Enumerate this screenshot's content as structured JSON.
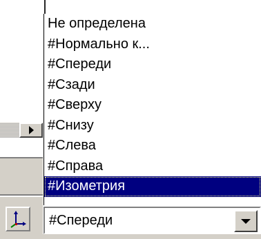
{
  "view_dropdown": {
    "items": [
      {
        "label": "Не определена",
        "selected": false
      },
      {
        "label": "#Нормально к...",
        "selected": false
      },
      {
        "label": "#Спереди",
        "selected": false
      },
      {
        "label": "#Сзади",
        "selected": false
      },
      {
        "label": "#Сверху",
        "selected": false
      },
      {
        "label": "#Снизу",
        "selected": false
      },
      {
        "label": "#Слева",
        "selected": false
      },
      {
        "label": "#Справа",
        "selected": false
      },
      {
        "label": "#Изометрия",
        "selected": true
      }
    ],
    "current_value": "#Спереди",
    "selection_color": "#000080"
  },
  "toolbar": {
    "scroll_button_icon": "triangle-right-icon",
    "axis_button_icon": "coordinate-axes-icon",
    "combo_button_icon": "triangle-down-icon"
  }
}
